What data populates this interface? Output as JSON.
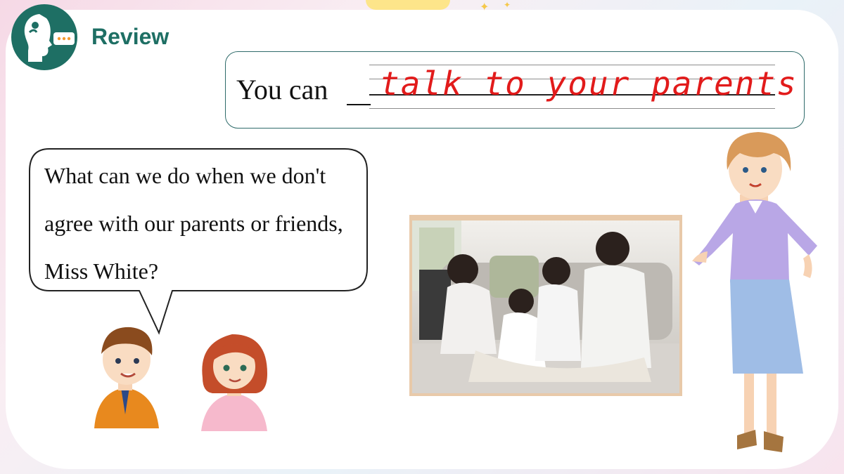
{
  "header": {
    "title": "Review",
    "icon": "speaking-head-icon"
  },
  "answer": {
    "prefix": "You can",
    "handwritten_answer": "talk to your parents",
    "answer_color": "#e21b1b"
  },
  "speech_bubble": {
    "lines": [
      "What can we do when we don't",
      "agree with our parents or friends,",
      "Miss White?"
    ]
  },
  "colors": {
    "brand": "#1e6f64",
    "box_border": "#2f6b6a"
  },
  "images": {
    "photo": "family-sitting-on-sofa-photo",
    "teacher": "miss-white-teacher-illustration",
    "boy": "boy-illustration",
    "girl": "girl-illustration"
  }
}
